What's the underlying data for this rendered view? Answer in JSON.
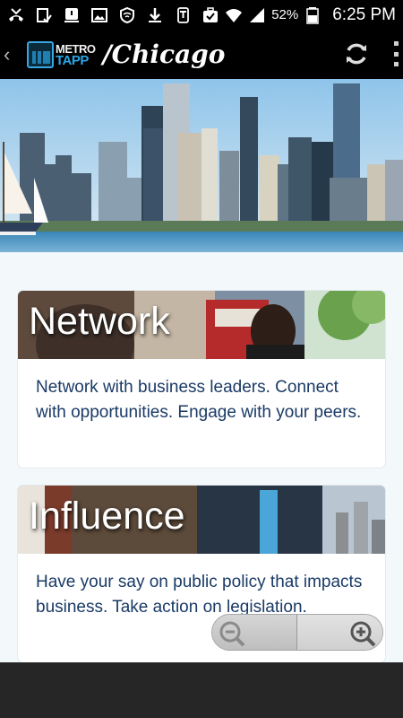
{
  "status_bar": {
    "battery": "52%",
    "time": "6:25 PM",
    "icons": [
      "missed-call-icon",
      "clipboard-icon",
      "voicemail-icon",
      "image-icon",
      "shield-icon",
      "download-icon",
      "t-mobile-icon",
      "briefcase-check-icon",
      "wifi-icon",
      "signal-icon",
      "battery-icon"
    ]
  },
  "app_bar": {
    "logo_top": "METRO",
    "logo_bottom": "TAPP",
    "city": "/Chicago",
    "refresh_icon": "refresh-icon",
    "overflow_icon": "overflow-menu-icon"
  },
  "cards": [
    {
      "title": "Network",
      "text": "Network with business leaders. Connect with opportunities. Engage with your peers."
    },
    {
      "title": "Influence",
      "text": "Have your say on public policy that impacts business. Take action on legislation."
    }
  ],
  "zoom": {
    "out_icon": "zoom-out-icon",
    "in_icon": "zoom-in-icon"
  },
  "colors": {
    "logo_accent": "#2aa5e6",
    "card_text": "#1a3a66",
    "content_bg": "#f3f8fb"
  }
}
